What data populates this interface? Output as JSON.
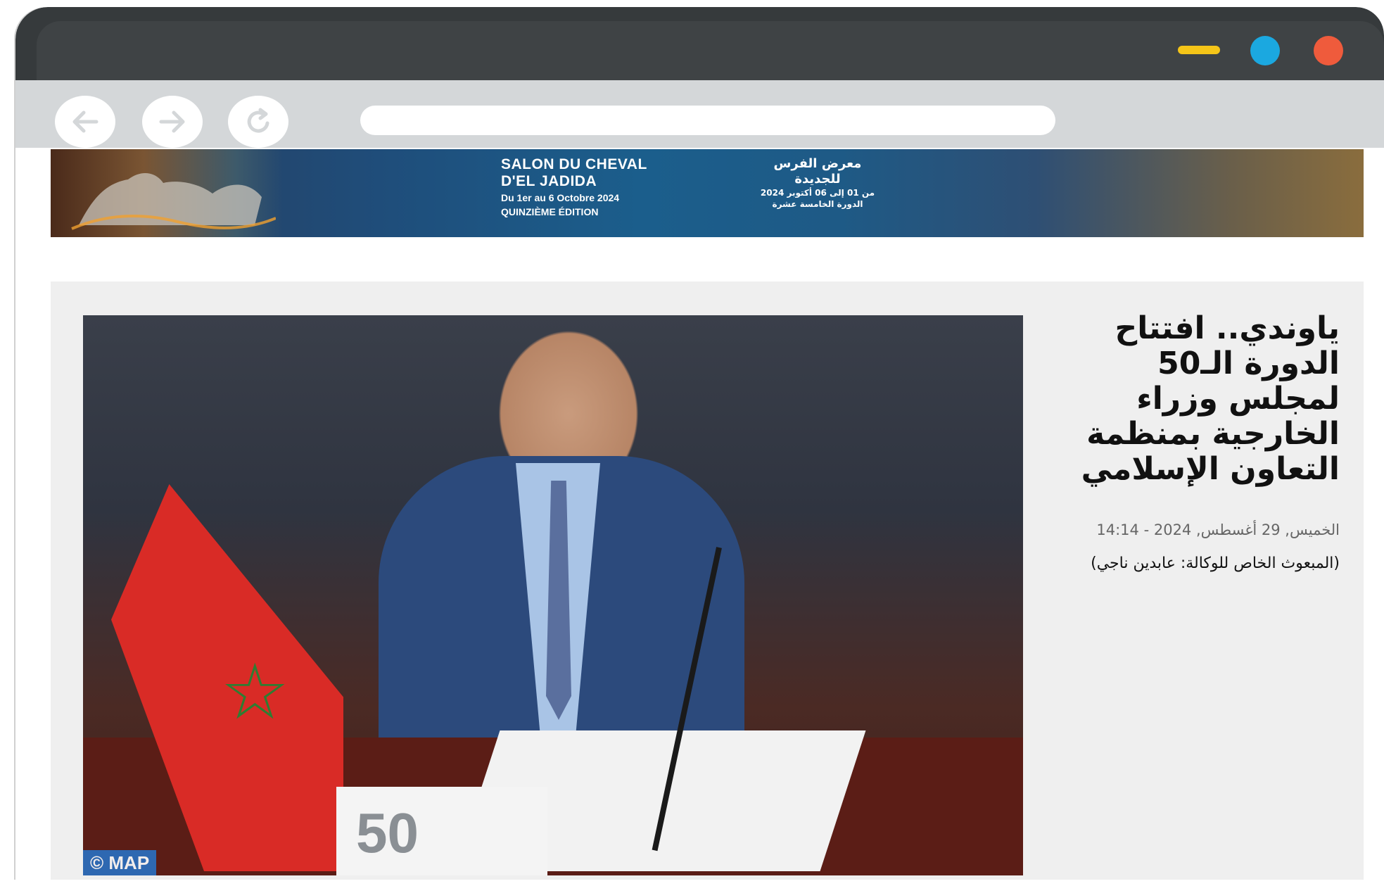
{
  "browser": {
    "controls": [
      "minimize",
      "maximize",
      "close"
    ],
    "colors": {
      "minimize": "#f5c518",
      "maximize": "#1ba8e0",
      "close": "#ef5b3c",
      "frame": "#363a3c",
      "toolbar": "#d4d7d9"
    },
    "nav_icons": [
      "back-arrow-icon",
      "forward-arrow-icon",
      "reload-icon"
    ],
    "url": ""
  },
  "banner": {
    "fr_line1": "SALON DU CHEVAL",
    "fr_line2": "D'EL JADIDA",
    "fr_line3": "Du 1er au 6 Octobre 2024",
    "fr_line4": "QUINZIÈME ÉDITION",
    "ar_line1": "معرض الفرس",
    "ar_line2": "للجديدة",
    "ar_line3": "من 01 إلى 06 أكتوبر 2024",
    "ar_line4": "الدورة الخامسة عشرة"
  },
  "article": {
    "title": "ياوندي.. افتتاح الدورة الـ50 لمجلس وزراء الخارجية بمنظمة التعاون الإسلامي",
    "date": "الخميس, 29 أغسطس, 2024 - 14:14",
    "byline": "(المبعوث الخاص للوكالة: عابدين ناجي)",
    "photo_credit": "© MAP",
    "nameplate_text": "50"
  }
}
